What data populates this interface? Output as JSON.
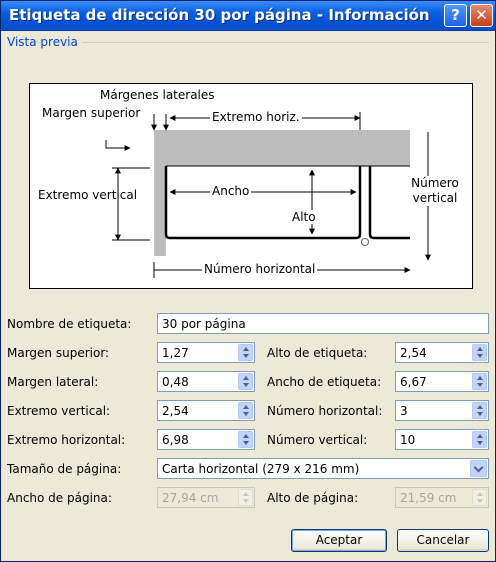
{
  "window": {
    "title": "Etiqueta de dirección 30 por página - Información",
    "help_glyph": "?",
    "close_glyph": "✕"
  },
  "preview": {
    "group_label": "Vista previa",
    "labels": {
      "side_margins": "Márgenes laterales",
      "top_margin": "Margen superior",
      "horizontal_pitch": "Extremo horiz.",
      "vertical_pitch": "Extremo vertical",
      "width": "Ancho",
      "height": "Alto",
      "number_down": "Número vertical",
      "number_across": "Número horizontal"
    }
  },
  "form": {
    "label_name": {
      "label": "Nombre de etiqueta:",
      "value": "30 por página"
    },
    "rows": [
      {
        "left_label": "Margen superior:",
        "left_value": "1,27",
        "right_label": "Alto de etiqueta:",
        "right_value": "2,54"
      },
      {
        "left_label": "Margen lateral:",
        "left_value": "0,48",
        "right_label": "Ancho de etiqueta:",
        "right_value": "6,67"
      },
      {
        "left_label": "Extremo vertical:",
        "left_value": "2,54",
        "right_label": "Número horizontal:",
        "right_value": "3"
      },
      {
        "left_label": "Extremo horizontal:",
        "left_value": "6,98",
        "right_label": "Número vertical:",
        "right_value": "10"
      }
    ],
    "page_size": {
      "label": "Tamaño de página:",
      "value": "Carta horizontal (279 x 216 mm)"
    },
    "page_width": {
      "label": "Ancho de página:",
      "value": "27,94 cm"
    },
    "page_height": {
      "label": "Alto de página:",
      "value": "21,59 cm"
    }
  },
  "buttons": {
    "ok": "Aceptar",
    "cancel": "Cancelar"
  }
}
